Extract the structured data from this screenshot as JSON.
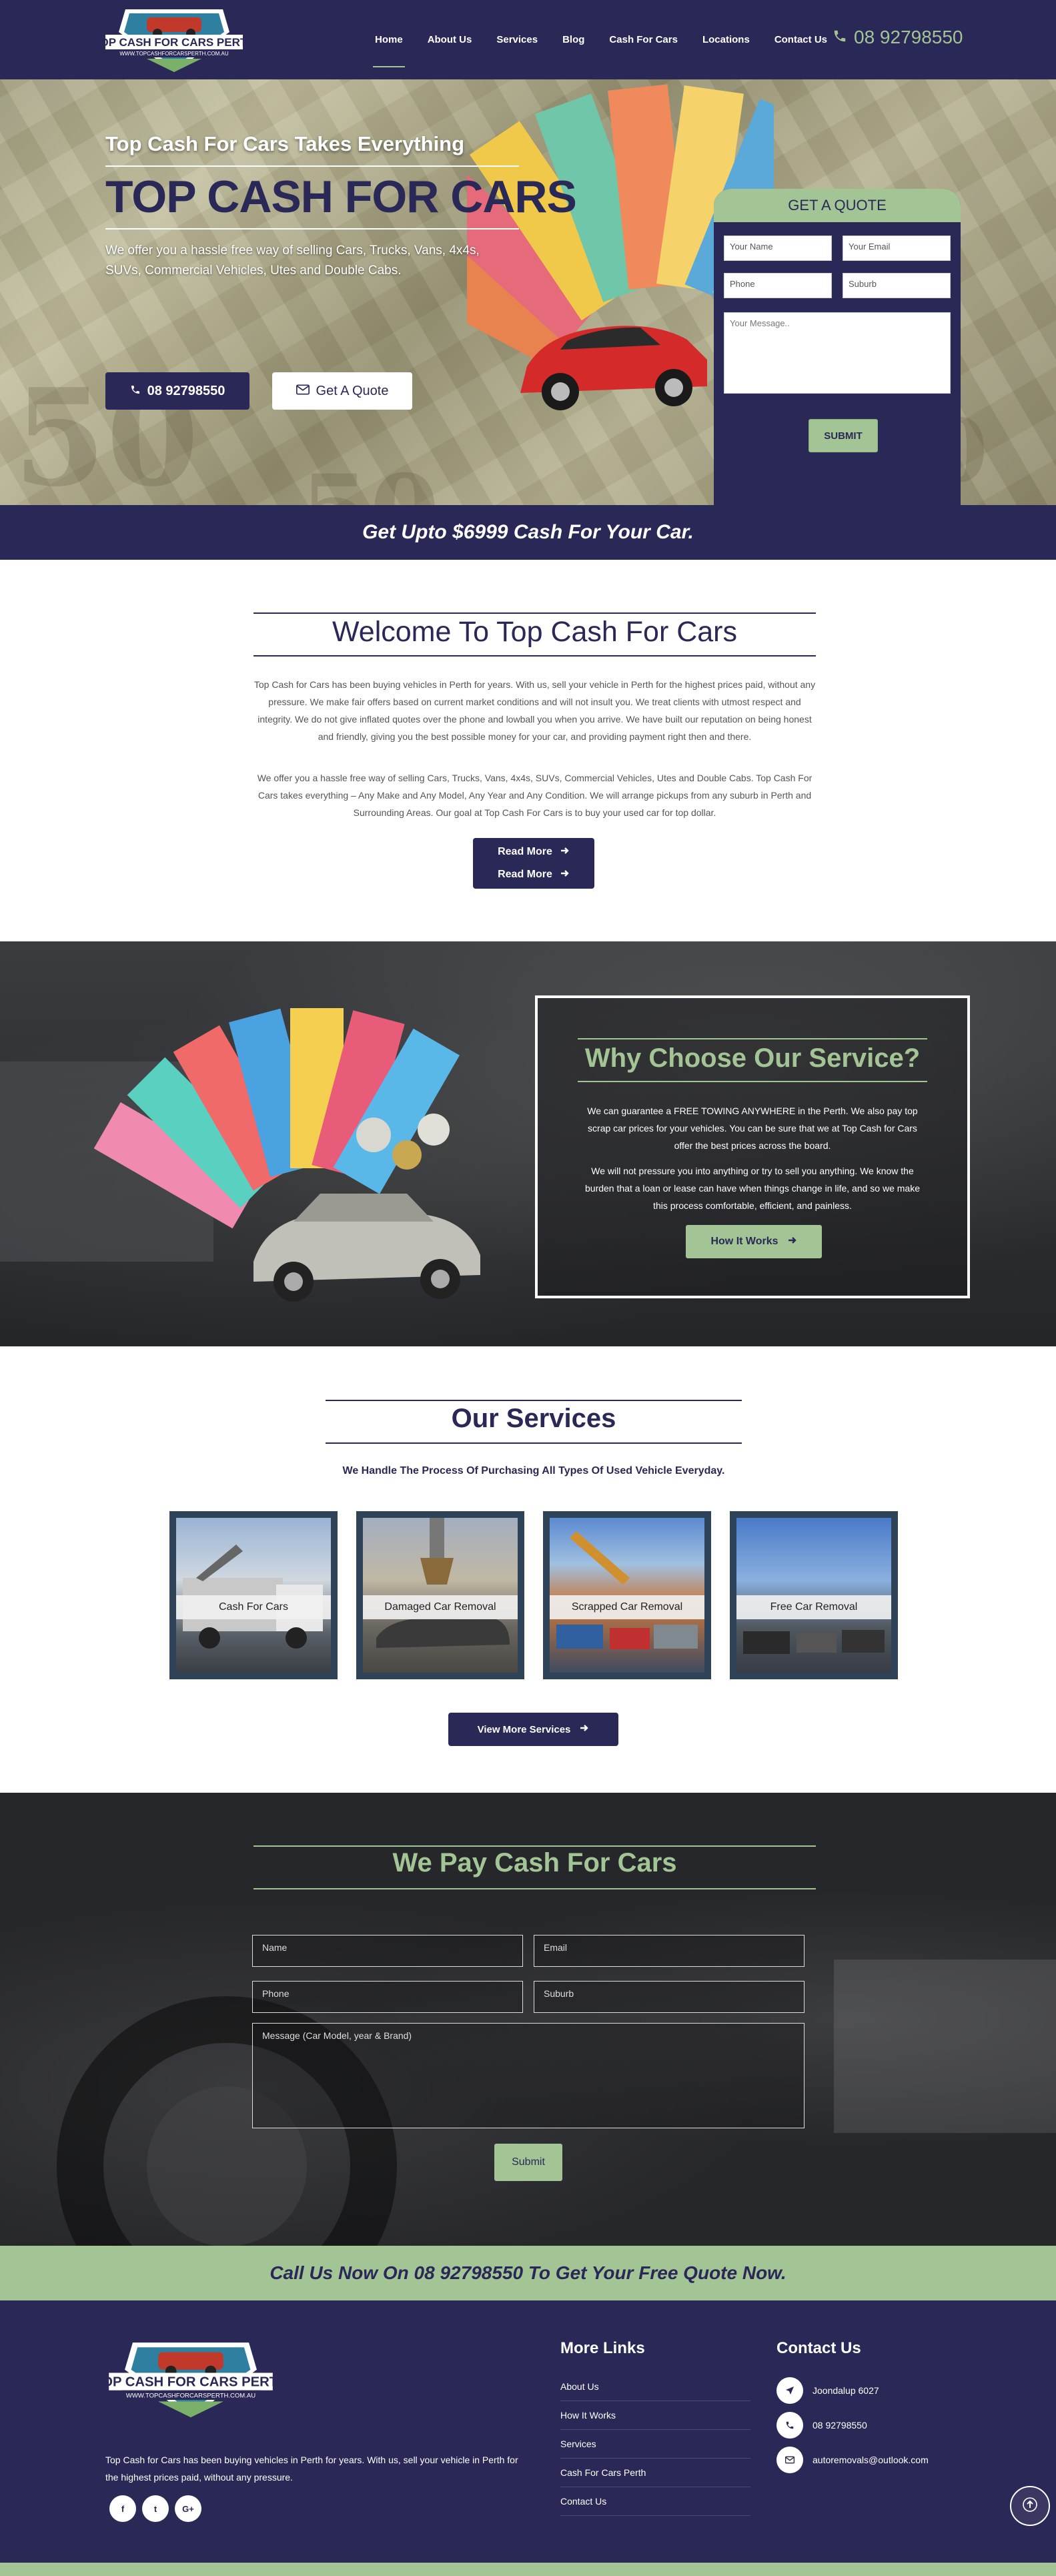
{
  "brand": {
    "logo_text": "TOP CASH FOR CARS PERTH",
    "logo_url": "WWW.TOPCASHFORCARSPERTH.COM.AU",
    "primary_color": "#2a2856",
    "accent_color": "#a3c495"
  },
  "nav": {
    "items": [
      {
        "label": "Home",
        "active": true
      },
      {
        "label": "About Us"
      },
      {
        "label": "Services"
      },
      {
        "label": "Blog"
      },
      {
        "label": "Cash For Cars"
      },
      {
        "label": "Locations"
      },
      {
        "label": "Contact Us"
      }
    ],
    "phone": "08 92798550",
    "phone_icon": "phone-icon"
  },
  "hero": {
    "subtitle": "Top Cash For Cars Takes Everything",
    "title": "TOP CASH FOR CARS",
    "description": "We offer you a hassle free way of selling Cars, Trucks, Vans, 4x4s, SUVs, Commercial Vehicles, Utes and Double Cabs.",
    "call_button": "08 92798550",
    "quote_button": "Get A Quote"
  },
  "quote_form": {
    "heading": "GET A QUOTE",
    "name_placeholder": "Your Name",
    "email_placeholder": "Your Email",
    "phone_placeholder": "Phone",
    "suburb_placeholder": "Suburb",
    "message_placeholder": "Your Message..",
    "submit_label": "SUBMIT"
  },
  "promo_strip": "Get Upto $6999 Cash For Your Car.",
  "welcome": {
    "title": "Welcome To Top Cash For Cars",
    "para1": "Top Cash for Cars has been buying vehicles in Perth for years. With us, sell your vehicle in Perth for the highest prices paid, without any pressure. We make fair offers based on current market conditions and will not insult you. We treat clients with utmost respect and integrity. We do not give inflated quotes over the phone and lowball you when you arrive. We have built our reputation on being honest and friendly, giving you the best possible money for your car, and providing payment right then and there.",
    "para2": "We offer you a hassle free way of selling Cars, Trucks, Vans, 4x4s, SUVs, Commercial Vehicles, Utes and Double Cabs. Top Cash For Cars takes everything – Any Make and Any Model, Any Year and Any Condition. We will arrange pickups from any suburb in Perth and Surrounding Areas. Our goal at Top Cash For Cars is to buy your used car for top dollar.",
    "read_more_1": "Read More",
    "read_more_2": "Read More"
  },
  "why": {
    "title": "Why Choose Our Service?",
    "para1": "We can guarantee a FREE TOWING ANYWHERE in the Perth. We also pay top scrap car prices for your vehicles. You can be sure that we at Top Cash for Cars offer the best prices across the board.",
    "para2": "We will not pressure you into anything or try to sell you anything. We know the burden that a loan or lease can have when things change in life, and so we make this process comfortable, efficient, and painless.",
    "button": "How It Works"
  },
  "services": {
    "title": "Our Services",
    "subtitle": "We Handle The Process Of Purchasing All Types Of Used Vehicle Everyday.",
    "cards": [
      {
        "label": "Cash For Cars"
      },
      {
        "label": "Damaged Car Removal"
      },
      {
        "label": "Scrapped Car Removal"
      },
      {
        "label": "Free Car Removal"
      }
    ],
    "more_button": "View More Services"
  },
  "pay": {
    "title": "We Pay Cash For Cars",
    "name_placeholder": "Name",
    "email_placeholder": "Email",
    "phone_placeholder": "Phone",
    "suburb_placeholder": "Suburb",
    "message_placeholder": "Message (Car Model, year & Brand)",
    "submit_label": "Submit"
  },
  "call_strip": "Call Us Now On 08 92798550 To Get Your Free Quote Now.",
  "footer": {
    "about": "Top Cash for Cars has been buying vehicles in Perth for years. With us, sell your vehicle in Perth for the highest prices paid, without any pressure.",
    "social": [
      "f",
      "t",
      "G+"
    ],
    "links_heading": "More Links",
    "links": [
      "About Us",
      "How It Works",
      "Services",
      "Cash For Cars Perth",
      "Contact Us"
    ],
    "contact_heading": "Contact Us",
    "contact": [
      {
        "icon": "location-arrow-icon",
        "text": "Joondalup 6027"
      },
      {
        "icon": "phone-icon",
        "text": "08 92798550"
      },
      {
        "icon": "envelope-icon",
        "text": "autoremovals@outlook.com"
      }
    ]
  }
}
